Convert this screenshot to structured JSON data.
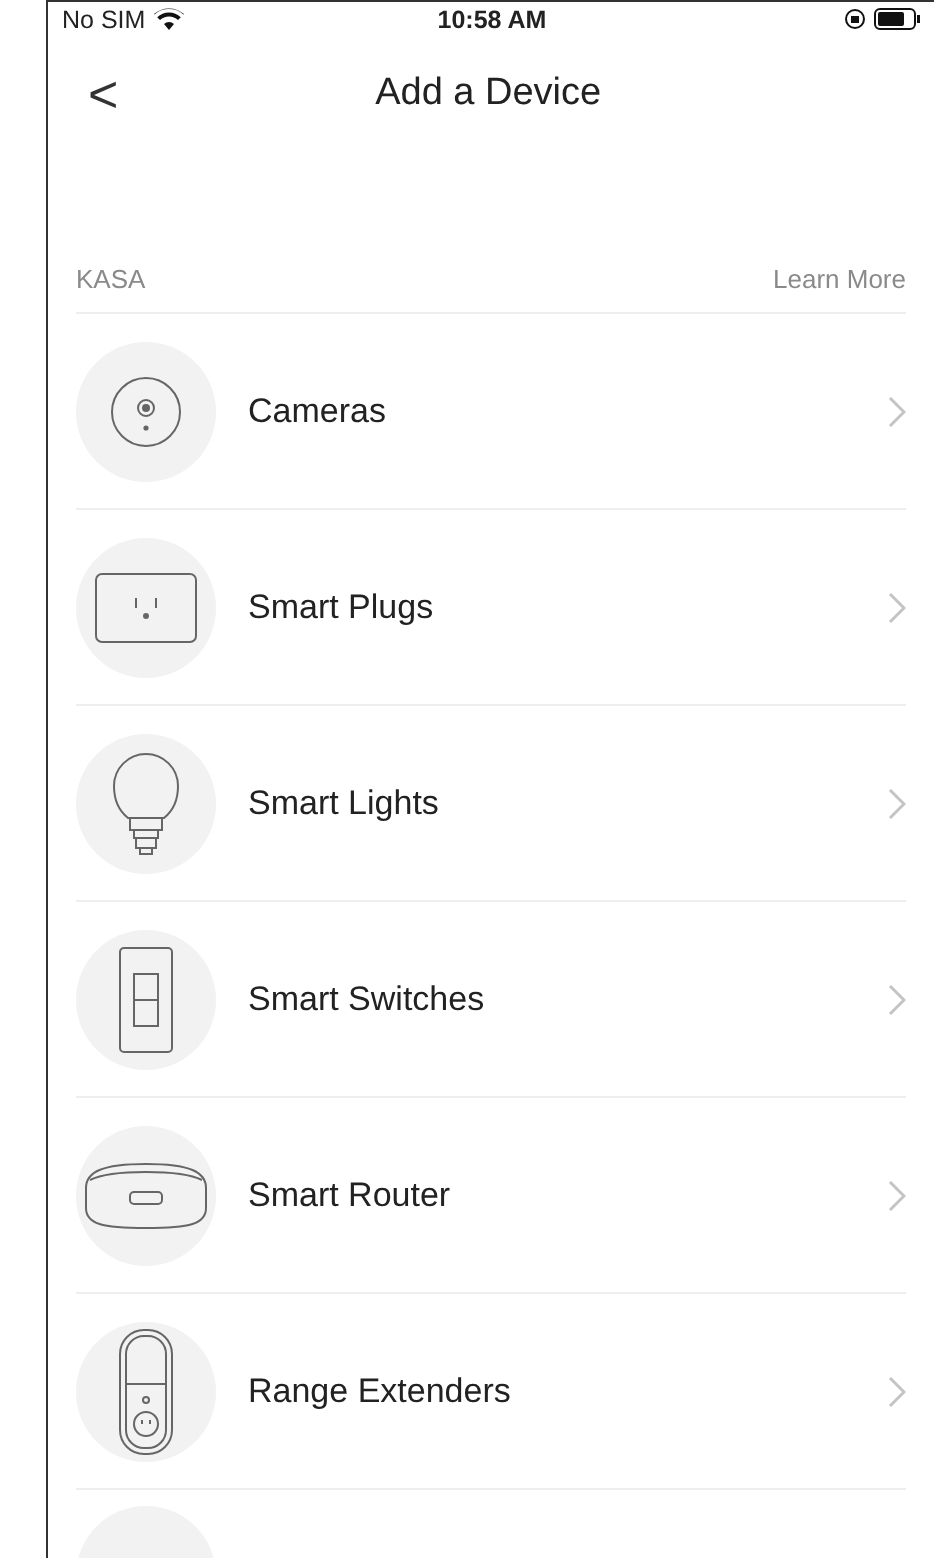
{
  "status_bar": {
    "carrier": "No SIM",
    "time": "10:58 AM"
  },
  "nav": {
    "back": "<",
    "title": "Add a Device"
  },
  "section": {
    "title": "KASA",
    "link": "Learn More"
  },
  "devices": [
    {
      "kind": "camera",
      "label": "Cameras"
    },
    {
      "kind": "plug",
      "label": "Smart Plugs"
    },
    {
      "kind": "bulb",
      "label": "Smart Lights"
    },
    {
      "kind": "switch",
      "label": "Smart Switches"
    },
    {
      "kind": "router",
      "label": "Smart Router"
    },
    {
      "kind": "extender",
      "label": "Range Extenders"
    }
  ]
}
